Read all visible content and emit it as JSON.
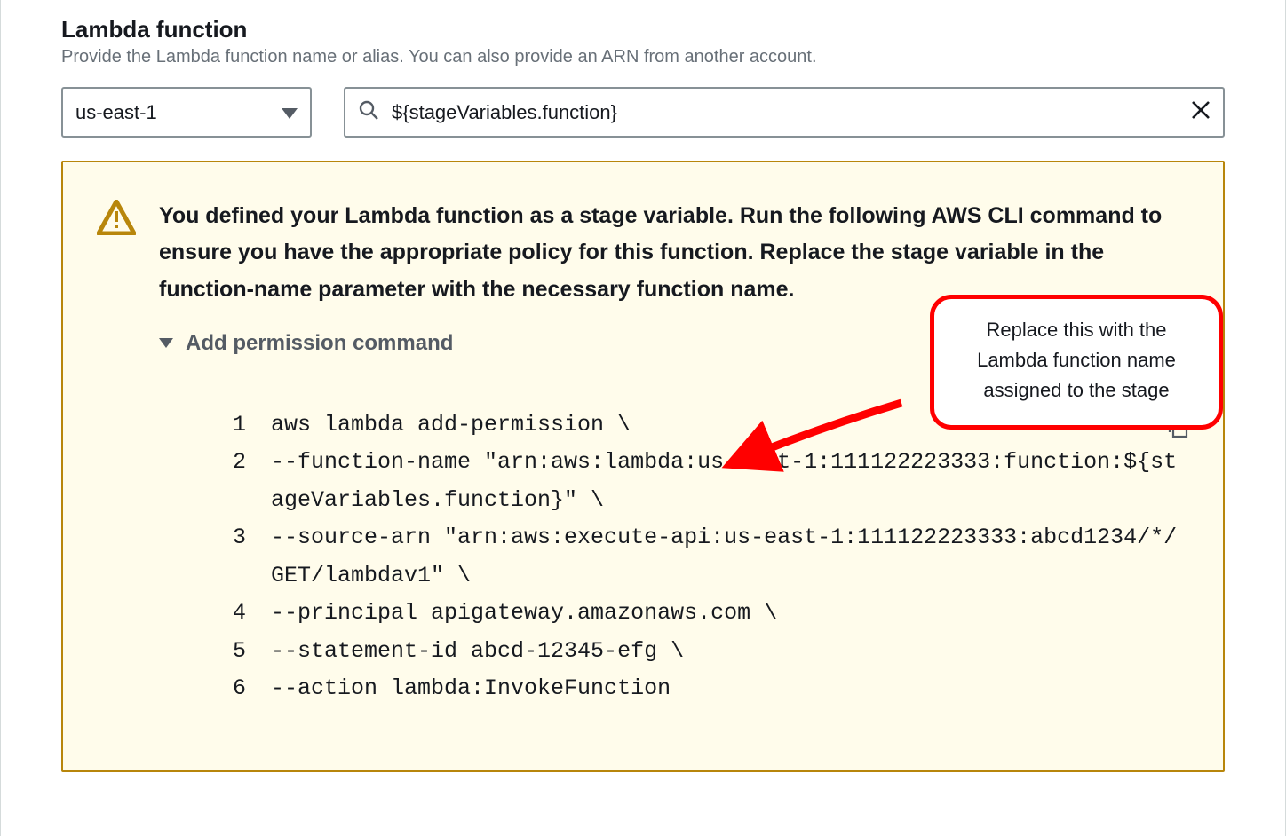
{
  "section": {
    "title": "Lambda function",
    "description": "Provide the Lambda function name or alias. You can also provide an ARN from another account."
  },
  "region_select": {
    "value": "us-east-1"
  },
  "search": {
    "value": "${stageVariables.function}"
  },
  "alert": {
    "title": "You defined your Lambda function as a stage variable. Run the following AWS CLI command to ensure you have the appropriate policy for this function. Replace the stage variable in the function-name parameter with the necessary function name.",
    "expander_title": "Add permission command"
  },
  "code": {
    "lines": [
      "aws lambda add-permission \\",
      "--function-name \"arn:aws:lambda:us-east-1:111122223333:function:${stageVariables.function}\" \\",
      "--source-arn \"arn:aws:execute-api:us-east-1:111122223333:abcd1234/*/GET/lambdav1\" \\",
      "--principal apigateway.amazonaws.com \\",
      "--statement-id abcd-12345-efg \\",
      "--action lambda:InvokeFunction"
    ]
  },
  "callout": {
    "text": "Replace this with the Lambda function name assigned to the stage"
  }
}
